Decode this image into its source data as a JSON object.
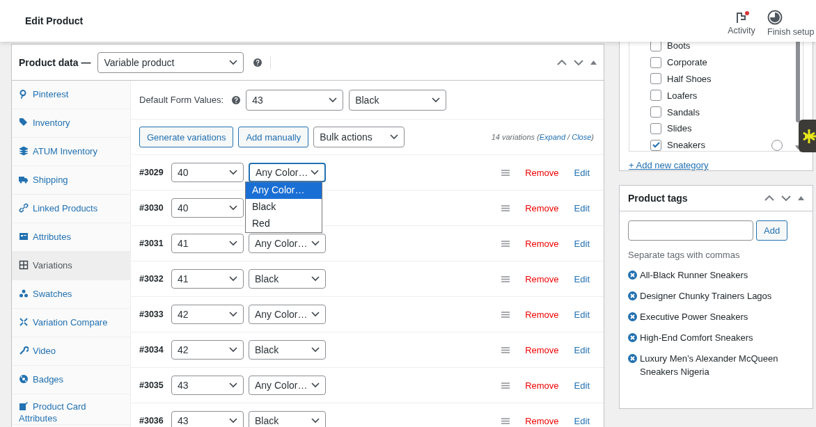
{
  "header": {
    "title": "Edit Product",
    "actions": [
      {
        "label": "Activity",
        "kind": "activity",
        "notification": true
      },
      {
        "label": "Finish setup",
        "kind": "progress",
        "notification": false
      }
    ]
  },
  "product_data": {
    "label": "Product data —",
    "type": "Variable product",
    "tabs": [
      {
        "label": "Pinterest",
        "selected": false
      },
      {
        "label": "Inventory",
        "selected": false
      },
      {
        "label": "ATUM Inventory",
        "selected": false
      },
      {
        "label": "Shipping",
        "selected": false
      },
      {
        "label": "Linked Products",
        "selected": false
      },
      {
        "label": "Attributes",
        "selected": false
      },
      {
        "label": "Variations",
        "selected": true
      },
      {
        "label": "Swatches",
        "selected": false
      },
      {
        "label": "Variation Compare",
        "selected": false
      },
      {
        "label": "Video",
        "selected": false
      },
      {
        "label": "Badges",
        "selected": false
      },
      {
        "label": "Product Card Attributes",
        "selected": false
      }
    ],
    "defaults": {
      "label": "Default Form Values:",
      "values": [
        "43",
        "Black"
      ]
    },
    "buttons": [
      "Generate variations",
      "Add manually"
    ],
    "bulk_select": "Bulk actions",
    "summary": {
      "prefix": "14 variations (",
      "links": [
        "Expand",
        "Close"
      ],
      "separator": " / ",
      "suffix": ")"
    },
    "variations": [
      {
        "id": "#3029",
        "size": "40",
        "color_value": "Any Color…",
        "open": true,
        "options": [
          {
            "label": "Any Color…",
            "selected": true
          },
          {
            "label": "Black",
            "selected": false
          },
          {
            "label": "Red",
            "selected": false
          }
        ],
        "remove": "Remove",
        "edit": "Edit"
      },
      {
        "id": "#3030",
        "size": "40",
        "open": false,
        "remove": "Remove",
        "edit": "Edit"
      },
      {
        "id": "#3031",
        "size": "41",
        "color_value": "Any Color…",
        "open": false,
        "remove": "Remove",
        "edit": "Edit"
      },
      {
        "id": "#3032",
        "size": "41",
        "color_value": "Black",
        "open": false,
        "remove": "Remove",
        "edit": "Edit"
      },
      {
        "id": "#3033",
        "size": "42",
        "color_value": "Any Color…",
        "open": false,
        "remove": "Remove",
        "edit": "Edit"
      },
      {
        "id": "#3034",
        "size": "42",
        "color_value": "Black",
        "open": false,
        "remove": "Remove",
        "edit": "Edit"
      },
      {
        "id": "#3035",
        "size": "43",
        "color_value": "Any Color…",
        "open": false,
        "remove": "Remove",
        "edit": "Edit"
      },
      {
        "id": "#3036",
        "size": "43",
        "color_value": "Black",
        "open": false,
        "remove": "Remove",
        "edit": "Edit"
      }
    ]
  },
  "categories": {
    "items": [
      {
        "label": "Boots",
        "checked": false,
        "primary": false
      },
      {
        "label": "Corporate",
        "checked": false,
        "primary": false
      },
      {
        "label": "Half Shoes",
        "checked": false,
        "primary": false
      },
      {
        "label": "Loafers",
        "checked": false,
        "primary": false
      },
      {
        "label": "Sandals",
        "checked": false,
        "primary": false
      },
      {
        "label": "Slides",
        "checked": false,
        "primary": false
      },
      {
        "label": "Sneakers",
        "checked": true,
        "primary": false
      }
    ],
    "add_link": "+ Add new category"
  },
  "product_tags": {
    "title": "Product tags",
    "button": "Add",
    "hint": "Separate tags with commas",
    "tags": [
      "All-Black Runner Sneakers",
      "Designer Chunky Trainers Lagos",
      "Executive Power Sneakers",
      "High-End Comfort Sneakers",
      "Luxury Men’s Alexander McQueen Sneakers Nigeria"
    ]
  }
}
